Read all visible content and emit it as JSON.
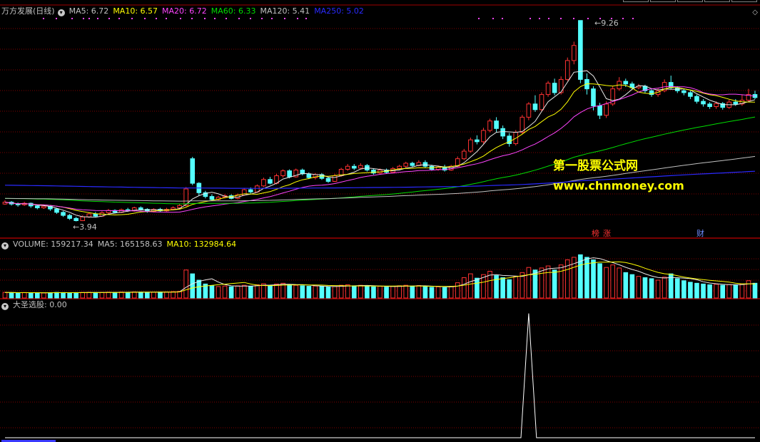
{
  "main_panel": {
    "title": "万方发展(日线)",
    "ma_labels": [
      {
        "name": "MA5",
        "value": "6.72",
        "color": "#c0c0c0"
      },
      {
        "name": "MA10",
        "value": "6.57",
        "color": "#ffff00"
      },
      {
        "name": "MA20",
        "value": "6.72",
        "color": "#ff44ff"
      },
      {
        "name": "MA60",
        "value": "6.33",
        "color": "#00dd00"
      },
      {
        "name": "MA120",
        "value": "5.41",
        "color": "#c0c0c0"
      },
      {
        "name": "MA250",
        "value": "5.02",
        "color": "#2a2aff"
      }
    ],
    "high_label": "9.26",
    "low_label": "3.94",
    "tags": [
      {
        "text": "榜",
        "color": "#ff3333"
      },
      {
        "text": "涨",
        "color": "#ff3333"
      },
      {
        "text": "财",
        "color": "#6f8cff"
      }
    ]
  },
  "watermark": {
    "line1": "第一股票公式网",
    "line2": "www.chnmoney.com",
    "color": "#ffff00"
  },
  "volume_panel": {
    "labels": [
      {
        "name": "VOLUME",
        "value": "159217.34",
        "color": "#c0c0c0"
      },
      {
        "name": "MA5",
        "value": "165158.63",
        "color": "#c0c0c0"
      },
      {
        "name": "MA10",
        "value": "132984.64",
        "color": "#ffff00"
      }
    ]
  },
  "indicator_panel": {
    "title": "大圣选股",
    "value": ": 0.00"
  },
  "colors": {
    "up": "#ff3232",
    "down": "#54ffff",
    "grid": "#800000",
    "divider": "#a00000",
    "ma5": "#e8e8e8",
    "ma10": "#ffff00",
    "ma20": "#ff44ff",
    "ma60": "#00dd00",
    "ma120": "#c0c0c0",
    "ma250": "#2a2aff"
  },
  "chart_data": [
    {
      "type": "candlestick",
      "panel": "price",
      "candles": [
        [
          4.4,
          4.45,
          4.5,
          4.38
        ],
        [
          4.45,
          4.4,
          4.48,
          4.36
        ],
        [
          4.4,
          4.38,
          4.44,
          4.33
        ],
        [
          4.38,
          4.42,
          4.46,
          4.35
        ],
        [
          4.42,
          4.35,
          4.44,
          4.3
        ],
        [
          4.35,
          4.3,
          4.38,
          4.26
        ],
        [
          4.3,
          4.34,
          4.38,
          4.27
        ],
        [
          4.34,
          4.27,
          4.36,
          4.22
        ],
        [
          4.27,
          4.18,
          4.3,
          4.14
        ],
        [
          4.18,
          4.1,
          4.22,
          4.06
        ],
        [
          4.1,
          4.02,
          4.14,
          3.98
        ],
        [
          4.02,
          3.96,
          4.06,
          3.94
        ],
        [
          3.96,
          4.06,
          4.1,
          3.95
        ],
        [
          4.06,
          4.14,
          4.18,
          4.03
        ],
        [
          4.14,
          4.08,
          4.19,
          4.05
        ],
        [
          4.08,
          4.17,
          4.21,
          4.06
        ],
        [
          4.17,
          4.23,
          4.27,
          4.14
        ],
        [
          4.23,
          4.18,
          4.26,
          4.15
        ],
        [
          4.18,
          4.25,
          4.28,
          4.16
        ],
        [
          4.25,
          4.22,
          4.3,
          4.19
        ],
        [
          4.22,
          4.3,
          4.33,
          4.2
        ],
        [
          4.3,
          4.26,
          4.34,
          4.23
        ],
        [
          4.26,
          4.2,
          4.29,
          4.17
        ],
        [
          4.2,
          4.26,
          4.29,
          4.18
        ],
        [
          4.26,
          4.22,
          4.3,
          4.19
        ],
        [
          4.22,
          4.26,
          4.3,
          4.2
        ],
        [
          4.26,
          4.3,
          4.34,
          4.24
        ],
        [
          4.3,
          4.36,
          4.4,
          4.28
        ],
        [
          4.36,
          4.8,
          4.85,
          4.34
        ],
        [
          5.6,
          4.95,
          5.65,
          4.9
        ],
        [
          4.95,
          4.7,
          4.98,
          4.62
        ],
        [
          4.7,
          4.6,
          4.75,
          4.55
        ],
        [
          4.6,
          4.52,
          4.66,
          4.48
        ],
        [
          4.52,
          4.58,
          4.62,
          4.49
        ],
        [
          4.58,
          4.62,
          4.66,
          4.55
        ],
        [
          4.62,
          4.55,
          4.66,
          4.52
        ],
        [
          4.55,
          4.64,
          4.68,
          4.52
        ],
        [
          4.64,
          4.78,
          4.82,
          4.62
        ],
        [
          4.78,
          4.72,
          4.84,
          4.68
        ],
        [
          4.72,
          4.88,
          4.92,
          4.7
        ],
        [
          4.88,
          5.05,
          5.1,
          4.85
        ],
        [
          5.05,
          4.95,
          5.12,
          4.92
        ],
        [
          4.95,
          5.15,
          5.2,
          4.92
        ],
        [
          5.15,
          5.28,
          5.32,
          5.1
        ],
        [
          5.28,
          5.12,
          5.32,
          5.08
        ],
        [
          5.12,
          5.3,
          5.34,
          5.1
        ],
        [
          5.3,
          5.2,
          5.34,
          5.16
        ],
        [
          5.2,
          5.1,
          5.24,
          5.06
        ],
        [
          5.1,
          5.18,
          5.22,
          5.05
        ],
        [
          5.18,
          5.08,
          5.22,
          5.04
        ],
        [
          5.08,
          5.0,
          5.12,
          4.96
        ],
        [
          5.0,
          5.15,
          5.2,
          4.98
        ],
        [
          5.15,
          5.32,
          5.36,
          5.12
        ],
        [
          5.32,
          5.4,
          5.46,
          5.28
        ],
        [
          5.4,
          5.35,
          5.46,
          5.3
        ],
        [
          5.35,
          5.42,
          5.48,
          5.32
        ],
        [
          5.42,
          5.3,
          5.46,
          5.26
        ],
        [
          5.3,
          5.22,
          5.34,
          5.18
        ],
        [
          5.22,
          5.3,
          5.34,
          5.18
        ],
        [
          5.3,
          5.24,
          5.34,
          5.2
        ],
        [
          5.24,
          5.34,
          5.38,
          5.22
        ],
        [
          5.34,
          5.4,
          5.44,
          5.3
        ],
        [
          5.4,
          5.48,
          5.52,
          5.36
        ],
        [
          5.48,
          5.42,
          5.52,
          5.38
        ],
        [
          5.42,
          5.5,
          5.56,
          5.4
        ],
        [
          5.5,
          5.4,
          5.56,
          5.36
        ],
        [
          5.4,
          5.32,
          5.44,
          5.28
        ],
        [
          5.32,
          5.38,
          5.42,
          5.28
        ],
        [
          5.38,
          5.3,
          5.44,
          5.26
        ],
        [
          5.3,
          5.4,
          5.44,
          5.28
        ],
        [
          5.4,
          5.6,
          5.66,
          5.38
        ],
        [
          5.6,
          5.8,
          5.86,
          5.56
        ],
        [
          5.8,
          6.1,
          6.16,
          5.76
        ],
        [
          6.1,
          6.05,
          6.22,
          5.98
        ],
        [
          6.05,
          6.35,
          6.42,
          6.0
        ],
        [
          6.35,
          6.6,
          6.66,
          6.3
        ],
        [
          6.6,
          6.4,
          6.7,
          6.3
        ],
        [
          6.4,
          6.2,
          6.48,
          6.12
        ],
        [
          6.2,
          6.0,
          6.28,
          5.92
        ],
        [
          6.0,
          6.3,
          6.36,
          5.95
        ],
        [
          6.3,
          6.7,
          6.76,
          6.25
        ],
        [
          6.7,
          7.05,
          7.1,
          6.62
        ],
        [
          7.05,
          6.9,
          7.28,
          6.84
        ],
        [
          6.9,
          7.3,
          7.36,
          6.85
        ],
        [
          7.3,
          7.6,
          7.66,
          7.24
        ],
        [
          7.6,
          7.35,
          7.72,
          7.28
        ],
        [
          7.35,
          7.7,
          7.78,
          7.3
        ],
        [
          7.7,
          8.2,
          8.28,
          7.66
        ],
        [
          8.2,
          8.6,
          8.7,
          8.1
        ],
        [
          9.26,
          7.7,
          9.26,
          7.6
        ],
        [
          7.7,
          7.45,
          7.86,
          7.3
        ],
        [
          7.45,
          7.0,
          7.52,
          6.88
        ],
        [
          7.0,
          6.75,
          7.08,
          6.65
        ],
        [
          6.75,
          7.05,
          7.12,
          6.68
        ],
        [
          7.05,
          7.45,
          7.52,
          7.0
        ],
        [
          7.45,
          7.65,
          7.76,
          7.4
        ],
        [
          7.65,
          7.58,
          7.72,
          7.5
        ],
        [
          7.58,
          7.48,
          7.64,
          7.42
        ],
        [
          7.48,
          7.52,
          7.58,
          7.44
        ],
        [
          7.52,
          7.4,
          7.56,
          7.34
        ],
        [
          7.4,
          7.3,
          7.44,
          7.24
        ],
        [
          7.3,
          7.4,
          7.46,
          7.24
        ],
        [
          7.4,
          7.62,
          7.7,
          7.36
        ],
        [
          7.62,
          7.48,
          7.8,
          7.44
        ],
        [
          7.48,
          7.4,
          7.52,
          7.34
        ],
        [
          7.4,
          7.35,
          7.46,
          7.28
        ],
        [
          7.35,
          7.25,
          7.4,
          7.18
        ],
        [
          7.25,
          7.12,
          7.3,
          7.06
        ],
        [
          7.12,
          7.05,
          7.18,
          6.98
        ],
        [
          7.05,
          6.98,
          7.1,
          6.92
        ],
        [
          6.98,
          7.06,
          7.12,
          6.92
        ],
        [
          7.06,
          6.96,
          7.1,
          6.9
        ],
        [
          6.96,
          7.1,
          7.16,
          6.92
        ],
        [
          7.1,
          7.05,
          7.18,
          7.0
        ],
        [
          7.05,
          7.15,
          7.3,
          7.0
        ],
        [
          7.15,
          7.3,
          7.45,
          7.12
        ],
        [
          7.3,
          7.22,
          7.4,
          7.18
        ]
      ],
      "candle_format": [
        "open",
        "close",
        "high",
        "low"
      ],
      "high_mark": 9.26,
      "low_mark": 3.94,
      "moving_averages": [
        "MA5",
        "MA10",
        "MA20",
        "MA60",
        "MA120",
        "MA250"
      ]
    },
    {
      "type": "bar",
      "panel": "volume",
      "series_name": "VOLUME",
      "values": [
        22000,
        21000,
        20000,
        21500,
        20500,
        21000,
        20000,
        21000,
        22000,
        21500,
        21000,
        20500,
        22000,
        22500,
        21500,
        22000,
        23000,
        22000,
        23500,
        22500,
        24000,
        23000,
        22500,
        23000,
        23500,
        24000,
        25000,
        26000,
        110000,
        95000,
        70000,
        55000,
        48000,
        45000,
        47000,
        44000,
        48000,
        50000,
        46000,
        52000,
        56000,
        50000,
        55000,
        58000,
        52000,
        50000,
        48000,
        46000,
        47000,
        45000,
        43000,
        45000,
        50000,
        52000,
        48000,
        50000,
        47000,
        44000,
        46000,
        43000,
        46000,
        48000,
        50000,
        47000,
        49000,
        45000,
        42000,
        44000,
        41000,
        46000,
        60000,
        80000,
        95000,
        78000,
        92000,
        105000,
        88000,
        80000,
        72000,
        85000,
        100000,
        120000,
        110000,
        118000,
        126000,
        110000,
        130000,
        150000,
        160000,
        170000,
        160000,
        150000,
        135000,
        120000,
        130000,
        118000,
        100000,
        92000,
        85000,
        80000,
        76000,
        70000,
        82000,
        95000,
        76000,
        68000,
        62000,
        58000,
        55000,
        52000,
        54000,
        50000,
        53000,
        52000,
        55000,
        68000,
        58000
      ],
      "ma5_last": 165158.63,
      "ma10_last": 132984.64
    },
    {
      "type": "line",
      "panel": "indicator",
      "series_name": "大圣选股",
      "value": 0.0,
      "signal_index": 81,
      "ylim": [
        0,
        1
      ]
    }
  ]
}
